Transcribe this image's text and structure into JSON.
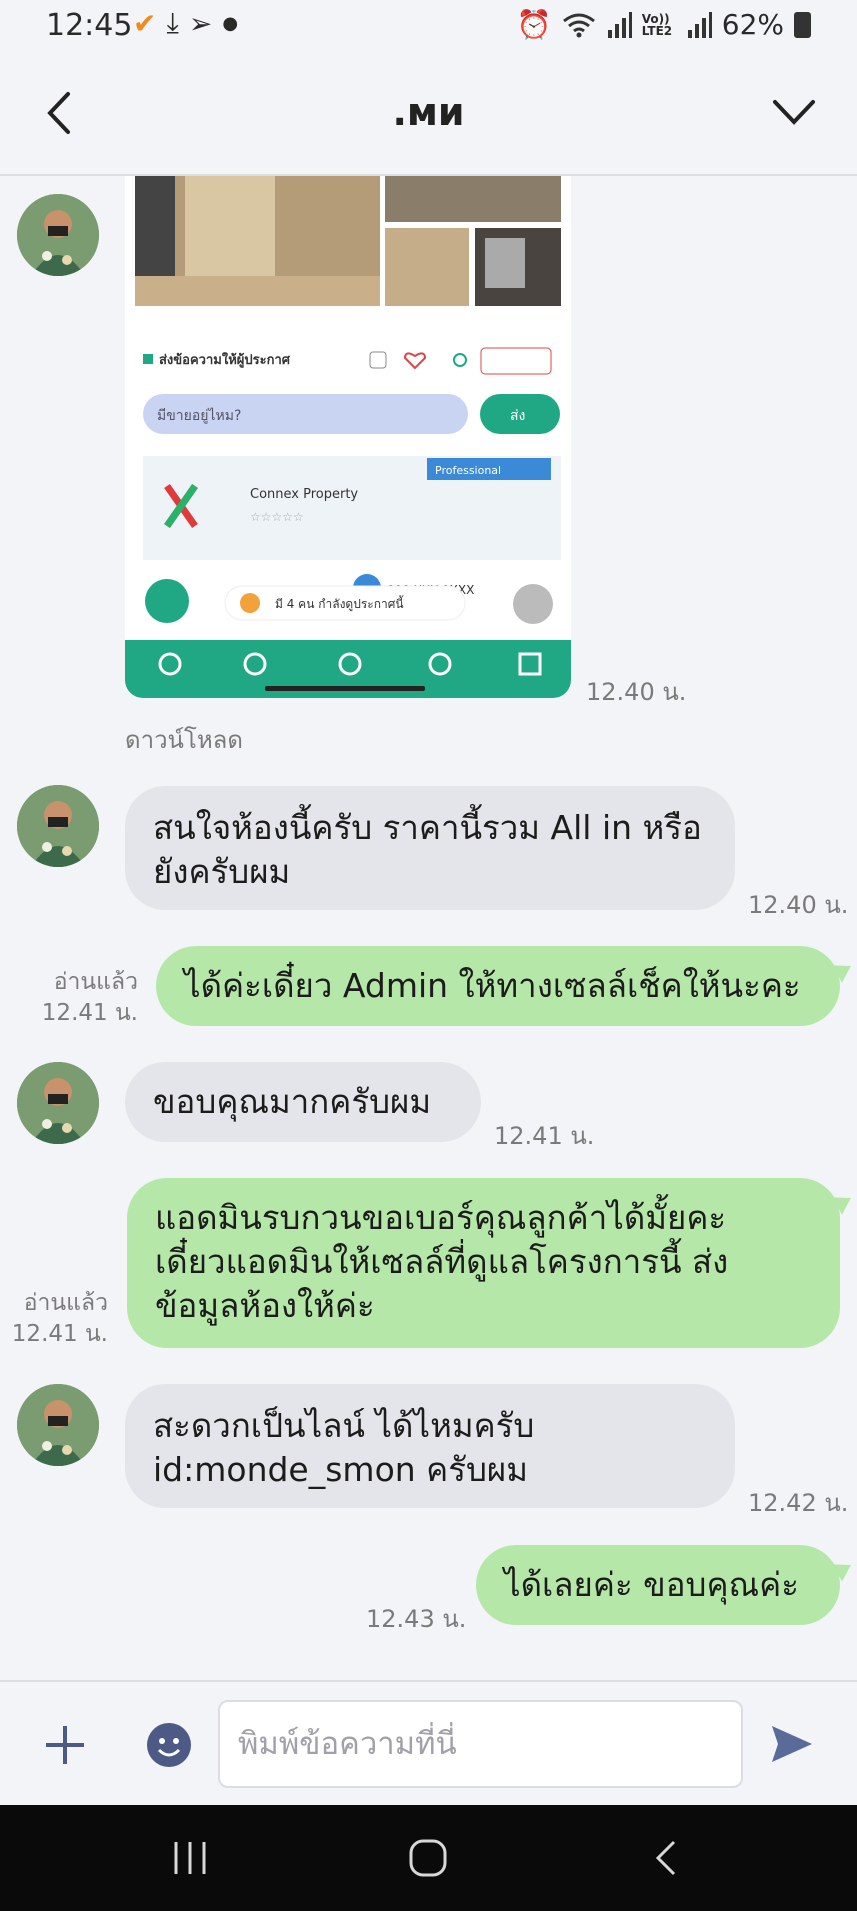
{
  "status_bar": {
    "time": "12:45",
    "volte": "Vo)) LTE2",
    "battery": "62%"
  },
  "header": {
    "title": ".ми"
  },
  "image_message": {
    "time": "12.40 น.",
    "download_label": "ดาวน์โหลด",
    "preview": {
      "contact_button": "ส่งข้อความให้ผู้ประกาศ",
      "question_placeholder": "มีขายอยู่ไหม?",
      "send_label": "ส่ง",
      "badge": "Professional",
      "company": "Connex Property",
      "phone": "090-XXX-9XXX",
      "viewers": "มี 4 คน กำลังดูประกาศนี้"
    }
  },
  "messages": [
    {
      "direction": "in",
      "text_lines": [
        "สนใจห้องนี้ครับ ราคานี้รวม All in หรือ",
        "ยังครับผม"
      ],
      "time": "12.40 น."
    },
    {
      "direction": "out",
      "text_lines": [
        "ได้ค่ะเดี๋ยว Admin ให้ทางเซลล์เช็คให้นะคะ"
      ],
      "read": "อ่านแล้ว",
      "time": "12.41 น."
    },
    {
      "direction": "in",
      "text_lines": [
        "ขอบคุณมากครับผม"
      ],
      "time": "12.41 น."
    },
    {
      "direction": "out",
      "text_lines": [
        "แอดมินรบกวนขอเบอร์คุณลูกค้าได้มั้ยคะ",
        "เดี๋ยวแอดมินให้เซลล์ที่ดูแลโครงการนี้ ส่ง",
        "ข้อมูลห้องให้ค่ะ"
      ],
      "read": "อ่านแล้ว",
      "time": "12.41 น."
    },
    {
      "direction": "in",
      "text_lines": [
        "สะดวกเป็นไลน์ ได้ไหมครับ",
        "id:monde_smon ครับผม"
      ],
      "time": "12.42 น."
    },
    {
      "direction": "out",
      "text_lines": [
        "ได้เลยค่ะ ขอบคุณค่ะ"
      ],
      "time": "12.43 น."
    }
  ],
  "input_bar": {
    "placeholder": "พิมพ์ข้อความที่นี่"
  },
  "colors": {
    "incoming_bubble": "#e4e5ea",
    "outgoing_bubble": "#b5e8a8",
    "preview_green": "#1fa883",
    "send_icon": "#5b6b99",
    "emoji_icon": "#4e5a86"
  }
}
